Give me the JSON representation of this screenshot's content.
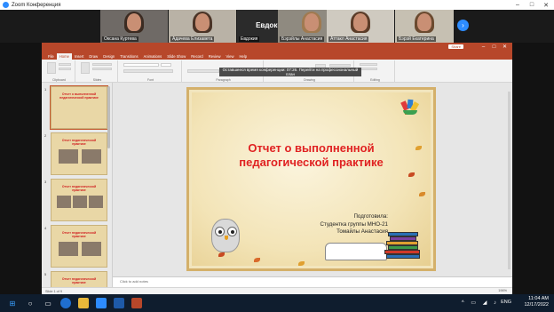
{
  "zoom": {
    "window_title": "Zoom Конференция",
    "participants": [
      {
        "name": "Оксана Куртева"
      },
      {
        "name": "Адачева Елизавета"
      },
      {
        "name": "Евдокия",
        "display": "Евдокия"
      },
      {
        "name": "Бэрэйлы Анастасия"
      },
      {
        "name": "Аттакл Анастасия"
      },
      {
        "name": "Бэрэй Екатерина"
      }
    ]
  },
  "powerpoint": {
    "share_button": "Share",
    "tabs": [
      "File",
      "Home",
      "Insert",
      "Draw",
      "Design",
      "Transitions",
      "Animations",
      "Slide Show",
      "Record",
      "Review",
      "View",
      "Help"
    ],
    "active_tab": "Home",
    "ribbon_groups": [
      "Clipboard",
      "Slides",
      "Font",
      "Paragraph",
      "Drawing",
      "Editing"
    ],
    "notice": {
      "line1": "Оставшееся время конференции: 07:26. Перейти на профессиональный план",
      "line2": ""
    },
    "slide": {
      "title_line1": "Отчет о выполненной",
      "title_line2": "педагогической практике",
      "presenter_line1": "Подготовила:",
      "presenter_line2": "Студентка группы МНО-21",
      "presenter_line3": "Томайлы Анастасия"
    },
    "thumbnails": [
      {
        "num": "1",
        "title": "Отчет о выполненной педагогической практике"
      },
      {
        "num": "2",
        "title": "Отчет педагогической практике"
      },
      {
        "num": "3",
        "title": "Отчет педагогической практике"
      },
      {
        "num": "4",
        "title": "Отчет педагогической практике"
      },
      {
        "num": "5",
        "title": "Отчет педагогической практике"
      }
    ],
    "notes_placeholder": "Click to add notes",
    "status_left": "Slide 1 of 9",
    "zoom_level": "196%"
  },
  "taskbar": {
    "time": "11:04 AM",
    "date": "12/17/2022",
    "lang": "ENG"
  }
}
